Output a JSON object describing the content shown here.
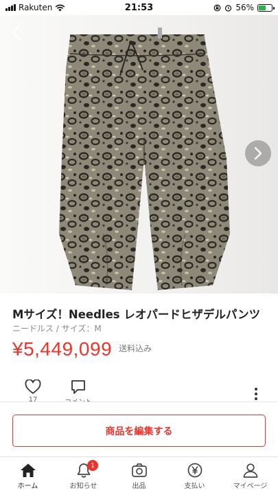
{
  "status_bar": {
    "carrier": "Rakuten",
    "time": "21:53",
    "battery_percent": "56%",
    "battery_level": 0.56,
    "icons": [
      "signal-icon",
      "wifi-icon",
      "orientation-lock-icon",
      "alarm-icon",
      "battery-icon"
    ]
  },
  "photo": {
    "description_icon": "leopard-pants-photo",
    "prev_icon": "chevron-left-icon",
    "next_icon": "chevron-right-icon"
  },
  "product": {
    "title": "Mサイズ！Needles レオパードヒザデルパンツ",
    "brand_size": "ニードルス / サイズ：M",
    "price": "¥5,449,099",
    "shipping": "送料込み"
  },
  "actions": {
    "like_count": "17",
    "comment_label": "コメント",
    "like_icon": "heart-icon",
    "comment_icon": "comment-icon",
    "more_icon": "more-vertical-icon"
  },
  "edit_button": {
    "label": "商品を編集する"
  },
  "tabbar": {
    "tabs": [
      {
        "label": "ホーム",
        "icon": "home-icon"
      },
      {
        "label": "お知らせ",
        "icon": "bell-icon",
        "badge": "1"
      },
      {
        "label": "出品",
        "icon": "camera-icon"
      },
      {
        "label": "支払い",
        "icon": "yen-icon"
      },
      {
        "label": "マイページ",
        "icon": "person-icon"
      }
    ]
  },
  "colors": {
    "accent": "#ea352d",
    "battery": "#2bb34a"
  }
}
